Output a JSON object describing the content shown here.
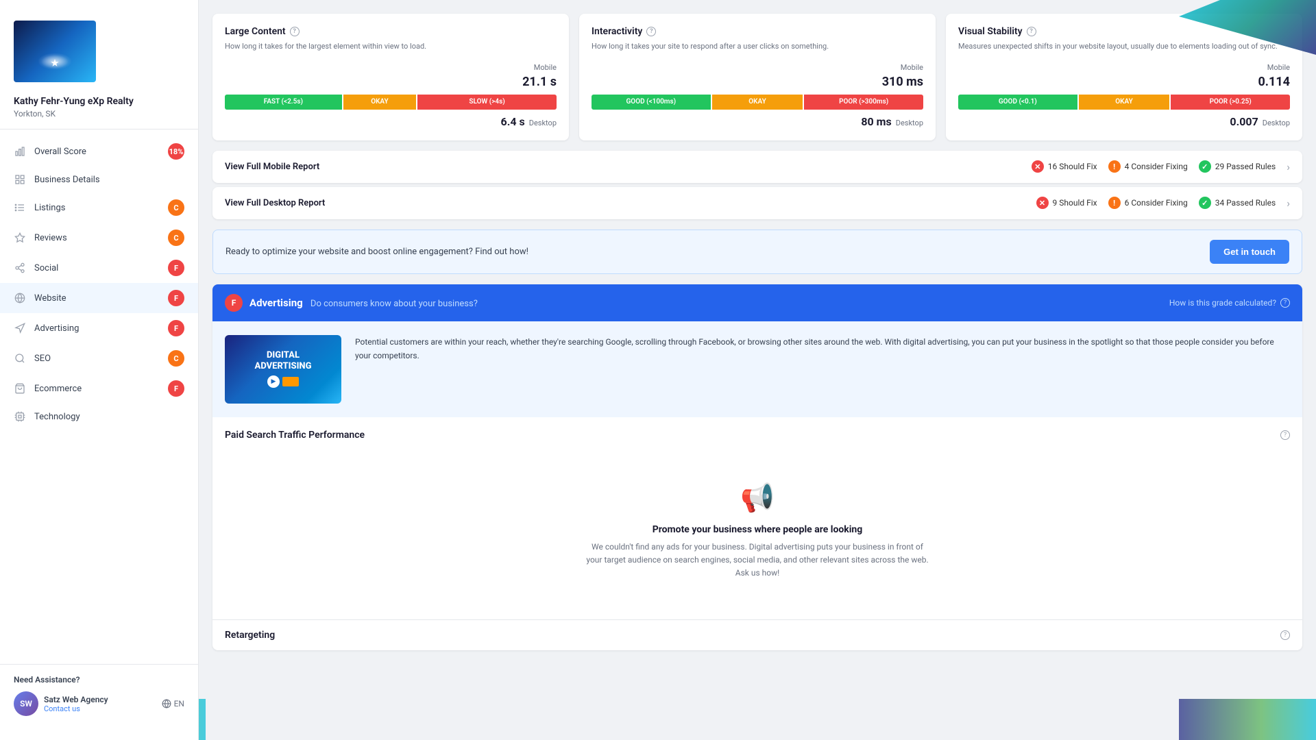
{
  "sidebar": {
    "business_name": "Kathy Fehr-Yung eXp Realty",
    "business_location": "Yorkton, SK",
    "menu_items": [
      {
        "id": "overall-score",
        "label": "Overall Score",
        "badge": "18%",
        "badge_type": "red",
        "icon": "chart-bar"
      },
      {
        "id": "business-details",
        "label": "Business Details",
        "badge": null,
        "icon": "grid"
      },
      {
        "id": "listings",
        "label": "Listings",
        "badge": "C",
        "badge_type": "orange",
        "icon": "list"
      },
      {
        "id": "reviews",
        "label": "Reviews",
        "badge": "C",
        "badge_type": "orange",
        "icon": "star"
      },
      {
        "id": "social",
        "label": "Social",
        "badge": "F",
        "badge_type": "red",
        "icon": "share"
      },
      {
        "id": "website",
        "label": "Website",
        "badge": "F",
        "badge_type": "red",
        "icon": "globe"
      },
      {
        "id": "advertising",
        "label": "Advertising",
        "badge": "F",
        "badge_type": "red",
        "icon": "megaphone"
      },
      {
        "id": "seo",
        "label": "SEO",
        "badge": "C",
        "badge_type": "orange",
        "icon": "search"
      },
      {
        "id": "ecommerce",
        "label": "Ecommerce",
        "badge": "F",
        "badge_type": "red",
        "icon": "shopping-bag"
      },
      {
        "id": "technology",
        "label": "Technology",
        "badge": null,
        "icon": "cpu"
      }
    ],
    "assistance": {
      "title": "Need Assistance?",
      "agency_name": "Satz Web Agency",
      "contact_label": "Contact us",
      "lang": "EN"
    }
  },
  "metrics": {
    "large_content": {
      "title": "Large Content",
      "description": "How long it takes for the largest element within view to load.",
      "mobile_label": "Mobile",
      "mobile_value": "21.1 s",
      "desktop_value": "6.4 s",
      "desktop_label": "Desktop",
      "bar_fast": "FAST (<2.5s)",
      "bar_okay": "OKAY",
      "bar_slow": "SLOW (>4s)"
    },
    "interactivity": {
      "title": "Interactivity",
      "description": "How long it takes your site to respond after a user clicks on something.",
      "mobile_label": "Mobile",
      "mobile_value": "310 ms",
      "desktop_value": "80 ms",
      "desktop_label": "Desktop",
      "bar_good": "GOOD (<100ms)",
      "bar_okay": "OKAY",
      "bar_poor": "POOR (>300ms)"
    },
    "visual_stability": {
      "title": "Visual Stability",
      "description": "Measures unexpected shifts in your website layout, usually due to elements loading out of sync.",
      "mobile_label": "Mobile",
      "mobile_value": "0.114",
      "desktop_value": "0.007",
      "desktop_label": "Desktop",
      "bar_good": "GOOD (<0.1)",
      "bar_okay": "OKAY",
      "bar_poor": "POOR (>0.25)"
    }
  },
  "reports": {
    "mobile": {
      "title": "View Full Mobile Report",
      "should_fix": "16 Should Fix",
      "consider_fixing": "4 Consider Fixing",
      "passed_rules": "29 Passed Rules"
    },
    "desktop": {
      "title": "View Full Desktop Report",
      "should_fix": "9 Should Fix",
      "consider_fixing": "6 Consider Fixing",
      "passed_rules": "34 Passed Rules"
    }
  },
  "cta": {
    "text": "Ready to optimize your website and boost online engagement? Find out how!",
    "button_label": "Get in touch"
  },
  "advertising": {
    "grade": "F",
    "title": "Advertising",
    "subtitle": "Do consumers know about your business?",
    "how_calculated": "How is this grade calculated?",
    "image_text": "DIGITAL\nADVERTISING",
    "description": "Potential customers are within your reach, whether they're searching Google, scrolling through Facebook, or browsing other sites around the web. With digital advertising, you can put your business in the spotlight so that those people consider you before your competitors.",
    "paid_search": {
      "title": "Paid Search Traffic Performance",
      "empty_icon": "📢",
      "empty_title": "Promote your business where people are looking",
      "empty_desc": "We couldn't find any ads for your business. Digital advertising puts your business in front of your target audience on search engines, social media, and other relevant sites across the web. Ask us how!"
    },
    "retargeting": {
      "title": "Retargeting"
    }
  }
}
